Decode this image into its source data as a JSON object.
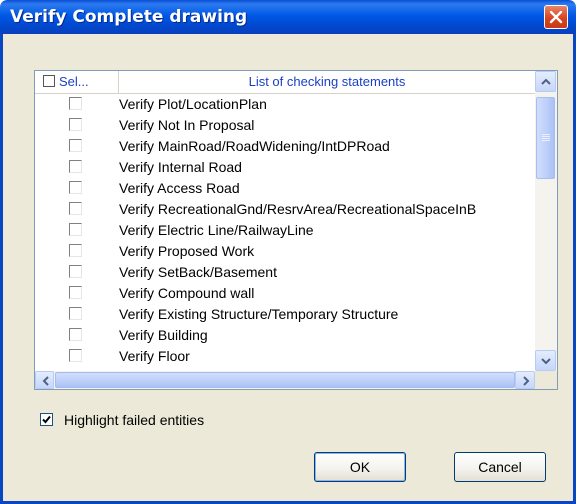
{
  "window": {
    "title": "Verify Complete drawing",
    "titlebar_color": "#0058e6",
    "close_icon": "close-icon"
  },
  "list": {
    "columns": [
      "Sel...",
      "List of checking statements"
    ],
    "rows": [
      {
        "checked": false,
        "label": "Verify Plot/LocationPlan"
      },
      {
        "checked": false,
        "label": "Verify Not In Proposal"
      },
      {
        "checked": false,
        "label": "Verify MainRoad/RoadWidening/IntDPRoad"
      },
      {
        "checked": false,
        "label": "Verify Internal Road"
      },
      {
        "checked": false,
        "label": "Verify Access Road"
      },
      {
        "checked": false,
        "label": "Verify RecreationalGnd/ResrvArea/RecreationalSpaceInB"
      },
      {
        "checked": false,
        "label": "Verify Electric Line/RailwayLine"
      },
      {
        "checked": false,
        "label": "Verify Proposed Work"
      },
      {
        "checked": false,
        "label": "Verify SetBack/Basement"
      },
      {
        "checked": false,
        "label": "Verify Compound wall"
      },
      {
        "checked": false,
        "label": "Verify Existing Structure/Temporary Structure"
      },
      {
        "checked": false,
        "label": "Verify Building"
      },
      {
        "checked": false,
        "label": "Verify Floor"
      }
    ]
  },
  "options": {
    "highlight_label": "Highlight failed entities",
    "highlight_checked": true
  },
  "buttons": {
    "ok": "OK",
    "cancel": "Cancel"
  }
}
